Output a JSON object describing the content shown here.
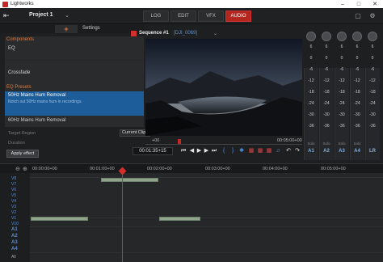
{
  "window": {
    "title": "Lightworks"
  },
  "header": {
    "project_title": "Project 1"
  },
  "tabs": [
    {
      "label": "LOG"
    },
    {
      "label": "EDIT"
    },
    {
      "label": "VFX"
    },
    {
      "label": "AUDIO",
      "active": true
    }
  ],
  "left_panel": {
    "settings_tab": "Settings",
    "components_head": "Components",
    "items": [
      {
        "label": "EQ"
      },
      {
        "label": "Crossfade"
      }
    ],
    "eq_presets_head": "EQ Presets",
    "selected_preset": {
      "label": "50Hz Mains Hum Removal",
      "description": "Notch out 50Hz mains hum in recordings."
    },
    "next_preset": "60Hz Mains Hum Removal",
    "target_region_label": "Target Region",
    "duration_label": "Duration",
    "clip_select_value": "Current Clip",
    "apply_label": "Apply effect"
  },
  "viewer": {
    "sequence_name": "Sequence #1",
    "clip_name": "[DJI_0069]",
    "tc_start": "+00",
    "tc_end": "00:05:00+00",
    "current_tc": "00:01:35+15"
  },
  "mixer": {
    "scale": [
      "6",
      "0",
      "-6",
      "-12",
      "-18",
      "-24",
      "-30",
      "-36"
    ],
    "channels": [
      {
        "name": "A1",
        "solo": "Solo"
      },
      {
        "name": "A2",
        "solo": "Solo"
      },
      {
        "name": "A3",
        "solo": "Solo"
      },
      {
        "name": "A4",
        "solo": "Solo"
      },
      {
        "name": "LR",
        "solo": ""
      }
    ]
  },
  "timeline": {
    "ruler": [
      "00:00:00+00",
      "00:01:00+00",
      "00:02:00+00",
      "00:03:00+00",
      "00:04:00+00",
      "00:05:00+00"
    ],
    "video_tracks": [
      "V8",
      "V7",
      "V6",
      "V5",
      "V4",
      "V3",
      "V2",
      "V1",
      "V10"
    ],
    "audio_tracks": [
      "A1",
      "A2",
      "A3",
      "A4"
    ],
    "all_label": "All"
  },
  "colors": {
    "accent_red": "#c62828",
    "selection_blue": "#1d5d99",
    "clip_green": "#8fa48a",
    "track_blue": "#5b8fd6",
    "orange": "#e07a3a"
  }
}
